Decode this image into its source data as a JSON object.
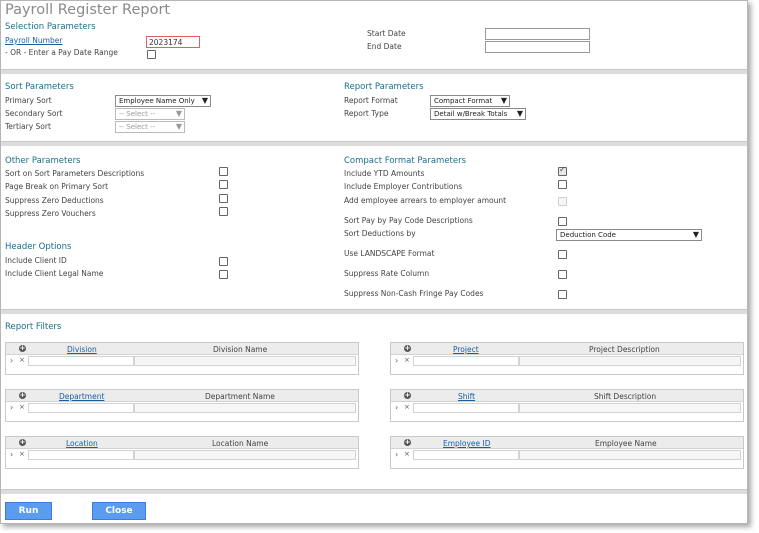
{
  "window_title": "Payroll Register Report",
  "selection": {
    "heading": "Selection Parameters",
    "payroll_number_label": "Payroll Number",
    "payroll_number_value": "2023174",
    "or_label": "- OR - Enter a Pay Date Range",
    "start_date_label": "Start Date",
    "end_date_label": "End Date",
    "start_date_value": "",
    "end_date_value": ""
  },
  "sort": {
    "heading": "Sort Parameters",
    "primary_label": "Primary Sort",
    "primary_value": "Employee Name Only",
    "secondary_label": "Secondary Sort",
    "secondary_value": "-- Select --",
    "tertiary_label": "Tertiary Sort",
    "tertiary_value": "-- Select --"
  },
  "report_params": {
    "heading": "Report Parameters",
    "format_label": "Report Format",
    "format_value": "Compact Format",
    "type_label": "Report Type",
    "type_value": "Detail w/Break Totals"
  },
  "other": {
    "heading": "Other Parameters",
    "items": [
      {
        "label": "Sort on Sort Parameters Descriptions",
        "checked": false
      },
      {
        "label": "Page Break on Primary Sort",
        "checked": false
      },
      {
        "label": "Suppress Zero Deductions",
        "checked": false
      },
      {
        "label": "Suppress Zero Vouchers",
        "checked": false
      }
    ]
  },
  "header_options": {
    "heading": "Header Options",
    "items": [
      {
        "label": "Include Client ID",
        "checked": false
      },
      {
        "label": "Include Client Legal Name",
        "checked": false
      }
    ]
  },
  "compact": {
    "heading": "Compact Format Parameters",
    "items": [
      {
        "label": "Include YTD Amounts",
        "checked": true
      },
      {
        "label": "Include Employer Contributions",
        "checked": false
      },
      {
        "label": "Add employee arrears to employer amount",
        "checked": false,
        "disabled": true
      },
      {
        "label": "Sort Pay by Pay Code Descriptions",
        "checked": false
      },
      {
        "label": "Sort Deductions by",
        "select": "Deduction Code"
      },
      {
        "label": "Use LANDSCAPE Format",
        "checked": false
      },
      {
        "label": "Suppress Rate Column",
        "checked": false
      },
      {
        "label": "Suppress Non-Cash Fringe Pay Codes",
        "checked": false
      }
    ]
  },
  "filters": {
    "heading": "Report Filters",
    "grids": [
      {
        "col1": "Division",
        "col2": "Division Name"
      },
      {
        "col1": "Project",
        "col2": "Project Description"
      },
      {
        "col1": "Department",
        "col2": "Department Name"
      },
      {
        "col1": "Shift",
        "col2": "Shift Description"
      },
      {
        "col1": "Location",
        "col2": "Location Name"
      },
      {
        "col1": "Employee ID",
        "col2": "Employee Name"
      }
    ]
  },
  "buttons": {
    "run": "Run",
    "close": "Close"
  },
  "colors": {
    "heading": "#1a6e8a",
    "link": "#1a5fa0",
    "button": "#5b9bf0",
    "error_border": "#e06060"
  },
  "icons": {
    "dropdown": "chevron-down-icon",
    "add_row": "plus-circle-icon",
    "expand_row": "chevron-right-icon",
    "delete_row": "close-icon",
    "checkbox_checked": "check-icon"
  }
}
